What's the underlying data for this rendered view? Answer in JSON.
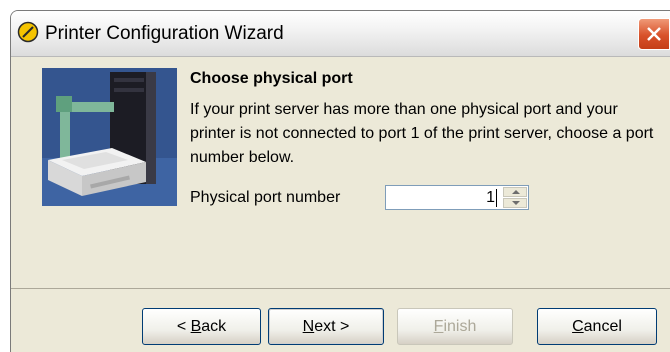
{
  "window": {
    "title": "Printer Configuration Wizard"
  },
  "page": {
    "heading": "Choose physical port",
    "description": "If your print server has more than one physical port and your printer is not connected to port 1 of the print server, choose a port number below.",
    "port_label": "Physical port number",
    "port_value": "1"
  },
  "buttons": {
    "back": {
      "prefix": "< ",
      "mnemonic": "B",
      "rest": "ack"
    },
    "next": {
      "mnemonic": "N",
      "rest": "ext >"
    },
    "finish": {
      "mnemonic": "F",
      "rest": "inish",
      "enabled": false
    },
    "cancel": {
      "mnemonic": "C",
      "rest": "ancel"
    }
  },
  "colors": {
    "close_button": "#d8512a",
    "illustration_bg": "#2f4e86",
    "disabled_text": "#aca899"
  }
}
